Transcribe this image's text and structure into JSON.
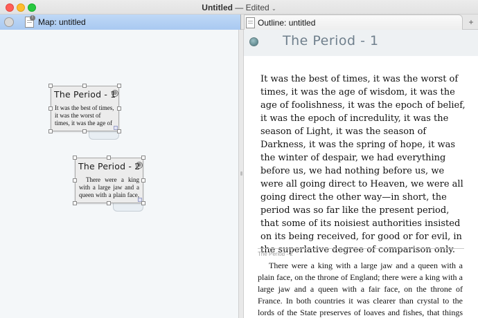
{
  "window": {
    "title": "Untitled",
    "separator": "—",
    "status": "Edited",
    "status_chevron": "⌄"
  },
  "tabs": {
    "map_label": "Map: untitled",
    "outline_label": "Outline: untitled",
    "plus": "+"
  },
  "map": {
    "cards": [
      {
        "title": "The Period - 1",
        "text": "It was the best of times, it was the worst of times, it was the age of"
      },
      {
        "title": "The Period - 2",
        "text": "There were a king with a large jaw and a queen with a plain face, on the throne of"
      }
    ],
    "plus_glyph": "⊕"
  },
  "outline": {
    "title": "The Period - 1",
    "section1_text": "It was the best of times, it was the worst of times, it was the age of wisdom, it was the age of foolishness, it was the epoch of belief, it was the epoch of incredulity, it was the season of Light, it was the season of Darkness, it was the spring of hope, it was the winter of despair, we had everything before us, we had nothing before us, we were all going direct to Heaven, we were all going direct the other way—in short, the period was so far like the present period, that some of its noisiest authorities insisted on its being received, for good or for evil, in the superlative degree of comparison only.",
    "section2_label": "The Period - 2",
    "section2_text": "There were a king with a large jaw and a queen with a plain face, on the throne of England; there were a king with a large jaw and a queen with a fair face, on the throne of France. In both countries it was clearer than crystal to the lords of the State preserves of loaves and fishes, that things in general were settled for ever."
  },
  "colors": {
    "tab_active": "#a9c9f1",
    "map_background": "#f4f7f9",
    "outline_title": "#6f7f8c"
  }
}
